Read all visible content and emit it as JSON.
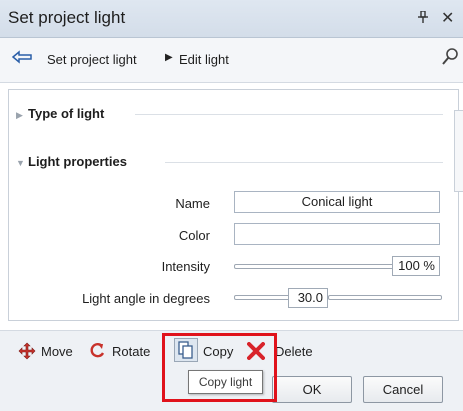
{
  "window": {
    "title": "Set project light",
    "pin_glyph": "ᵖ",
    "close_glyph": "✕"
  },
  "nav": {
    "back_icon": "back-arrow-icon",
    "crumb_root": "Set project light",
    "crumb_current": "Edit light",
    "search_icon": "search-icon"
  },
  "sections": {
    "type_of_light": "Type of light",
    "light_properties": "Light properties"
  },
  "properties": {
    "name_label": "Name",
    "name_value": "Conical light",
    "color_label": "Color",
    "color_value": "",
    "intensity_label": "Intensity",
    "intensity_value": "100 %",
    "intensity_fraction": 1.0,
    "angle_label": "Light angle in degrees",
    "angle_value": "30.0"
  },
  "toolbar": {
    "move_label": "Move",
    "rotate_label": "Rotate",
    "copy_label": "Copy",
    "delete_label": "Delete",
    "copy_tooltip": "Copy light"
  },
  "buttons": {
    "ok": "OK",
    "cancel": "Cancel"
  },
  "colors": {
    "highlight": "#e0121b",
    "delete_icon": "#d8232a",
    "move_icon": "#c8322b"
  }
}
